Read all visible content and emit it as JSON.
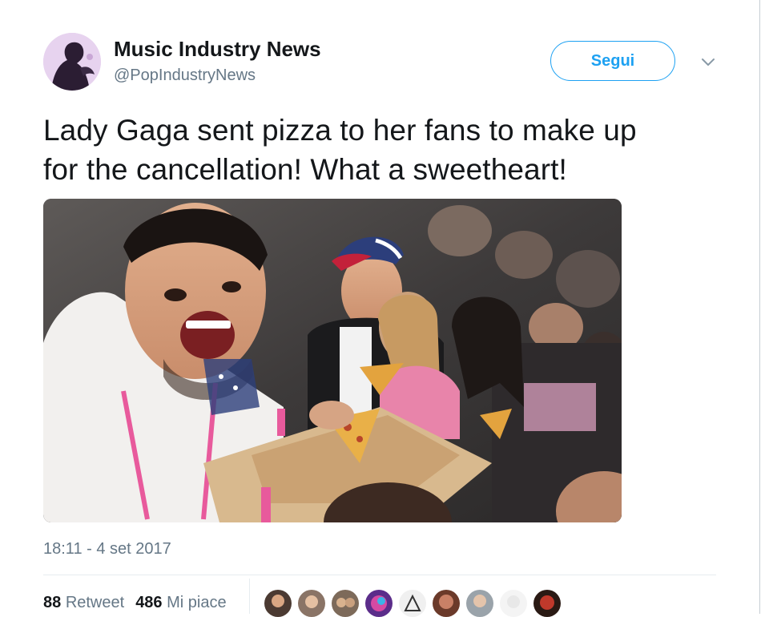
{
  "user": {
    "name": "Music Industry News",
    "handle": "@PopIndustryNews"
  },
  "follow_button": {
    "label": "Segui",
    "color": "#1da1f2"
  },
  "tweet": {
    "text_line1": "Lady Gaga sent pizza to her fans to make up",
    "text_line2": "for the cancellation! What a sweetheart!"
  },
  "timestamp": "18:11 - 4 set 2017",
  "stats": {
    "retweets_count": "88",
    "retweets_label": "Retweet",
    "likes_count": "486",
    "likes_label": "Mi piace"
  },
  "colors": {
    "accent": "#1da1f2",
    "text": "#14171a",
    "secondary": "#657786",
    "divider": "#e6ecf0"
  },
  "icons": {
    "more": "chevron-down-icon"
  }
}
